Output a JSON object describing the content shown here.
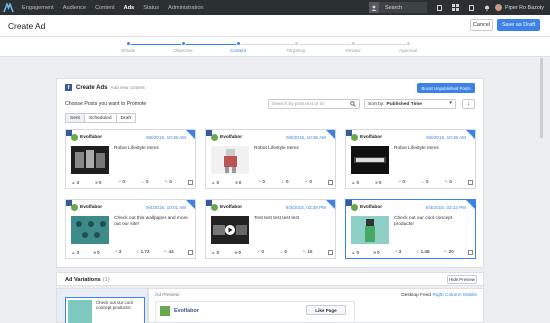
{
  "topbar": {
    "nav": [
      "Engagement",
      "Audience",
      "Content",
      "Ads",
      "Status",
      "Administration"
    ],
    "active_nav": "Ads",
    "search_label": "Search",
    "user_name": "Piper Ro Bazoty"
  },
  "header": {
    "title": "Create Ad",
    "cancel_label": "Cancel",
    "save_draft_label": "Save as Draft"
  },
  "stepper": {
    "steps": [
      "Details",
      "Objective",
      "Content",
      "Targeting",
      "Review",
      "Approval"
    ],
    "active_step": "Content"
  },
  "panel": {
    "title": "Create Ads",
    "subtitle": "Add new content",
    "boost_label": "Boost Unpublished Posts",
    "choose_label": "Choose Posts you want to Promote",
    "search_placeholder": "Search by post text or id",
    "sort_prefix": "Sort by:",
    "sort_value": "Published Time",
    "tabs": [
      "Sent",
      "Scheduled",
      "Draft"
    ],
    "active_tab": "Sent"
  },
  "posts": [
    {
      "page": "Evolfabor",
      "date": "9/8/2015, 10:36 AM",
      "text": "Robot Lifestyle Items",
      "stats": [
        "3",
        "0",
        "0",
        "0",
        "0"
      ]
    },
    {
      "page": "Evolfabor",
      "date": "9/8/2015, 10:36 AM",
      "text": "Robot Lifestyle Items",
      "stats": [
        "0",
        "0",
        "0",
        "0",
        "0"
      ]
    },
    {
      "page": "Evolfabor",
      "date": "9/8/2015, 10:36 AM",
      "text": "Robot Lifestyle Items",
      "stats": [
        "0",
        "0",
        "0",
        "0",
        "0"
      ]
    },
    {
      "page": "Evolfabor",
      "date": "9/4/2015, 10:01 AM",
      "text": "Check out this wallpaper and more out our site!",
      "stats": [
        "3",
        "0",
        "3",
        "1.72",
        "42"
      ]
    },
    {
      "page": "Evolfabor",
      "date": "9/3/2015, 03:39 PM",
      "text": "Test test test test test",
      "stats": [
        "0",
        "0",
        "0",
        "0",
        "10"
      ]
    },
    {
      "page": "Evolfabor",
      "date": "9/3/2015, 02:12 PM",
      "text": "Check out our cool concept products!",
      "stats": [
        "0",
        "0",
        "3",
        "1.48",
        "20"
      ]
    }
  ],
  "variations": {
    "title": "Ad Variations",
    "count": "(1)",
    "hide_preview_label": "Hide Preview",
    "item_text": "Check out our cool concept products!",
    "ad_preview_label": "Ad Preview",
    "feed_prefix": "Desktop Feed",
    "feed_links": [
      "Right Column",
      "Mobile"
    ],
    "preview_page": "Evolfabor",
    "like_label": "Like Page"
  },
  "colors": {
    "accent": "#3b83e6",
    "topbar": "#2b3033",
    "facebook": "#3b5998"
  }
}
